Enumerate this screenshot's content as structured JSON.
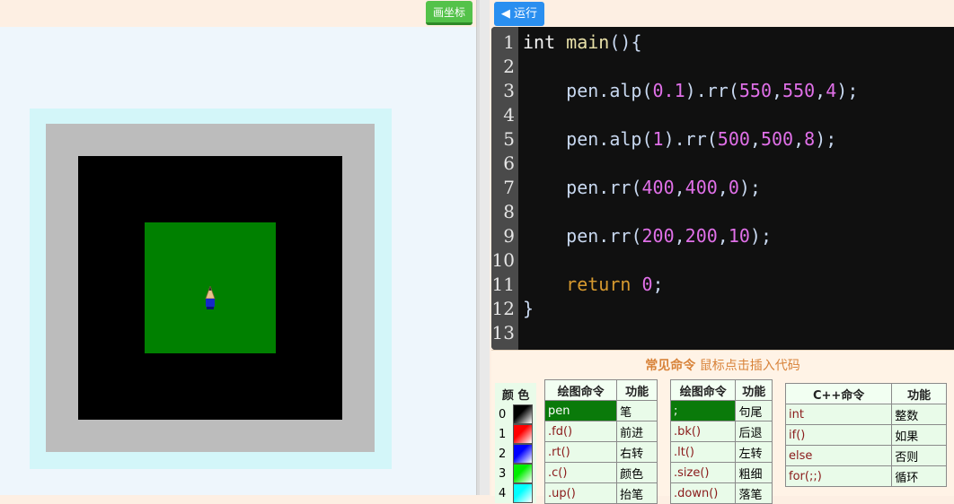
{
  "toolbar": {
    "draw_coords_label": "画坐标",
    "run_label": "◀ 运行"
  },
  "editor": {
    "lines": [
      {
        "n": "1",
        "code": "int main(){"
      },
      {
        "n": "2",
        "code": ""
      },
      {
        "n": "3",
        "code": "    pen.alp(0.1).rr(550,550,4);"
      },
      {
        "n": "4",
        "code": ""
      },
      {
        "n": "5",
        "code": "    pen.alp(1).rr(500,500,8);"
      },
      {
        "n": "6",
        "code": ""
      },
      {
        "n": "7",
        "code": "    pen.rr(400,400,0);"
      },
      {
        "n": "8",
        "code": ""
      },
      {
        "n": "9",
        "code": "    pen.rr(200,200,10);"
      },
      {
        "n": "10",
        "code": ""
      },
      {
        "n": "11",
        "code": "    return 0;"
      },
      {
        "n": "12",
        "code": "}"
      },
      {
        "n": "13",
        "code": ""
      }
    ]
  },
  "commands": {
    "title_bold": "常见命令",
    "title_rest": " 鼠标点击插入代码",
    "color_header": "颜 色",
    "colors": [
      {
        "idx": "0",
        "hex": "#000000"
      },
      {
        "idx": "1",
        "hex": "#ff0000"
      },
      {
        "idx": "2",
        "hex": "#0000ff"
      },
      {
        "idx": "3",
        "hex": "#00ee00"
      },
      {
        "idx": "4",
        "hex": "#00ffff"
      }
    ],
    "table1": {
      "headers": [
        "绘图命令",
        "功能"
      ],
      "rows": [
        [
          "pen",
          "笔"
        ],
        [
          ".fd()",
          "前进"
        ],
        [
          ".rt()",
          "右转"
        ],
        [
          ".c()",
          "颜色"
        ],
        [
          ".up()",
          "抬笔"
        ]
      ]
    },
    "table2": {
      "headers": [
        "绘图命令",
        "功能"
      ],
      "rows": [
        [
          ";",
          "句尾"
        ],
        [
          ".bk()",
          "后退"
        ],
        [
          ".lt()",
          "左转"
        ],
        [
          ".size()",
          "粗细"
        ],
        [
          ".down()",
          "落笔"
        ]
      ]
    },
    "table3": {
      "headers": [
        "C++命令",
        "功能"
      ],
      "rows": [
        [
          "int",
          "整数"
        ],
        [
          "if()",
          "如果"
        ],
        [
          "else",
          "否则"
        ],
        [
          "for(;;)",
          "循环"
        ]
      ]
    }
  }
}
